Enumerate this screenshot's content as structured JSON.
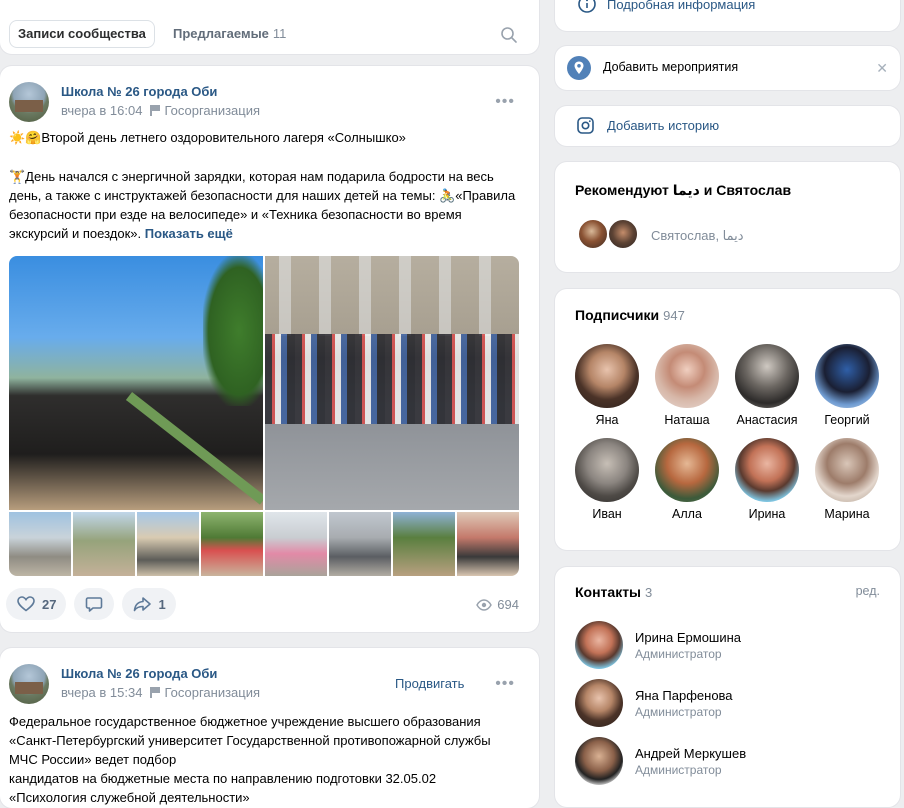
{
  "tabs": {
    "active": "Записи сообщества",
    "suggested": "Предлагаемые",
    "suggested_count": "11"
  },
  "posts": [
    {
      "author": "Школа № 26 города Оби",
      "time": "вчера в 16:04",
      "category": "Госорганизация",
      "title_line": "☀️🤗Второй день летнего оздоровительного лагеря «Солнышко»",
      "body": "🏋️День начался с энергичной зарядки, которая нам подарила бодрости на весь день, а также с инструктажей безопасности для наших детей на темы: 🚴«Правила безопасности при езде на велосипеде» и «Техника безопасности во время экскурсий и поездок». ",
      "show_more": "Показать ещё",
      "likes": "27",
      "reposts": "1",
      "views": "694"
    },
    {
      "author": "Школа № 26 города Оби",
      "time": "вчера в 15:34",
      "category": "Госорганизация",
      "promote": "Продвигать",
      "body_lines": [
        "Федеральное государственное бюджетное учреждение высшего образования",
        "«Санкт-Петербургский университет Государственной противопожарной службы",
        "МЧС России» ведет подбор",
        "кандидатов на бюджетные места по направлению подготовки 32.05.02",
        "«Психология служебной деятельности»"
      ]
    }
  ],
  "sidebar": {
    "info_link": "Подробная информация",
    "add_event": "Добавить мероприятия",
    "add_story": "Добавить историю",
    "recommend_title": "Рекомендуют دیما и Святослав",
    "recommend_names": "Святослав, دیما",
    "subscribers_title": "Подписчики",
    "subscribers_count": "947",
    "subscribers": [
      "Яна",
      "Наташа",
      "Анастасия",
      "Георгий",
      "Иван",
      "Алла",
      "Ирина",
      "Марина"
    ],
    "contacts_title": "Контакты",
    "contacts_count": "3",
    "contacts_edit": "ред.",
    "contacts": [
      {
        "name": "Ирина Ермошина",
        "role": "Администратор"
      },
      {
        "name": "Яна Парфенова",
        "role": "Администратор"
      },
      {
        "name": "Андрей Меркушев",
        "role": "Администратор"
      }
    ]
  },
  "colors": {
    "link": "#2a5885",
    "secondary": "#818c99",
    "background": "#edeef0"
  }
}
